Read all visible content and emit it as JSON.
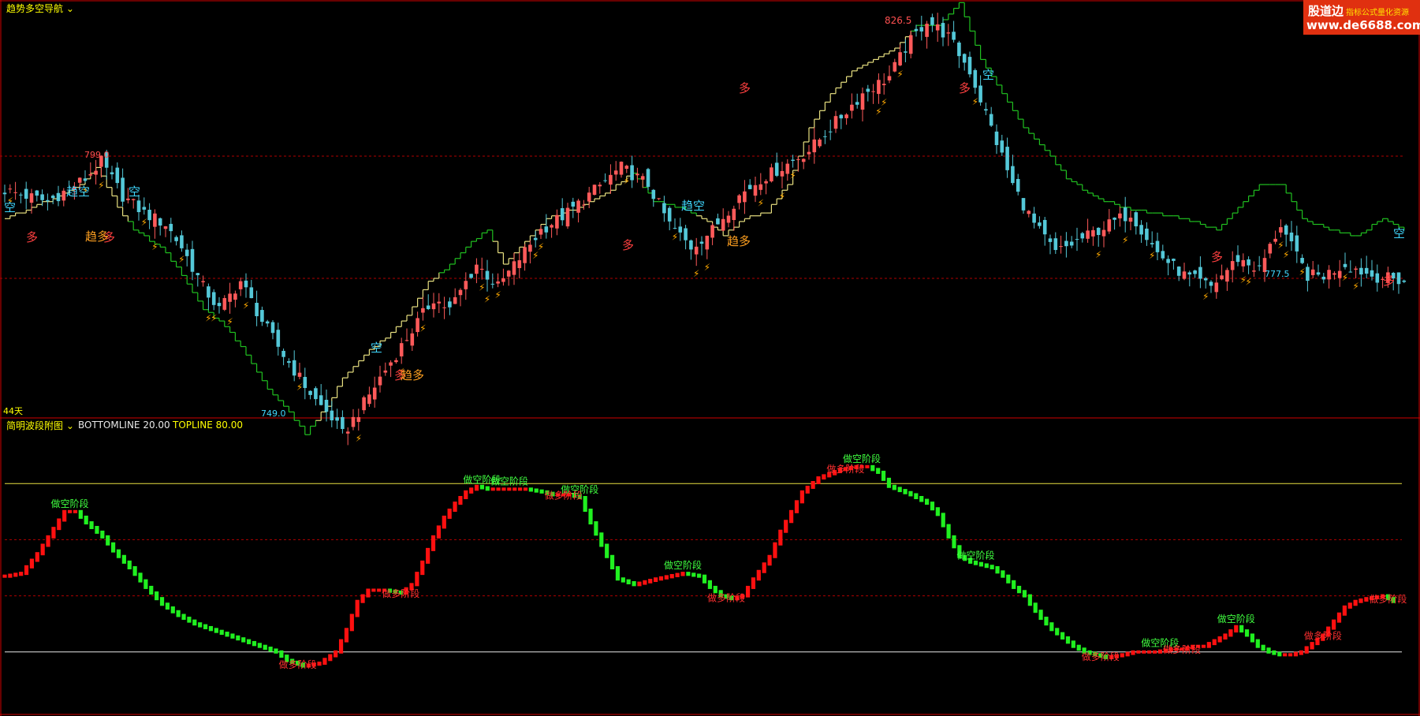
{
  "panels": {
    "main": {
      "title": "趋势多空导航",
      "days_label": "44天",
      "price_high_label": "826.5",
      "left_high_label": "799.0",
      "low_label": "749.0",
      "right_low_label": "777.5"
    },
    "sub": {
      "title": "简明波段附图",
      "bottom_label": "BOTTOMLINE 20.00",
      "top_label": "TOPLINE 80.00"
    }
  },
  "watermark": {
    "brand": "股道边",
    "tagline": "指标公式量化资源",
    "url": "www.de6688.com"
  },
  "colors": {
    "up": "#ff5a5a",
    "down": "#54c8d8",
    "bull_bar": "#ff1010",
    "bear_bar": "#20f020",
    "stop_up": "#e8e080",
    "stop_down": "#20c020",
    "grid": "#b00000",
    "frame": "#d00000"
  },
  "chart_data": [
    {
      "type": "candlestick",
      "title": "趋势多空导航",
      "reference_prices": [
        799.0,
        777.5
      ],
      "annotations": {
        "high": "826.5",
        "low": "749.0",
        "left_high": "799.0",
        "right_low": "777.5",
        "bull_text": "多",
        "bear_text": "空",
        "trend_bull_text": "趋多",
        "trend_bear_text": "趋空"
      },
      "close_path": [
        [
          0,
          793
        ],
        [
          8,
          791
        ],
        [
          15,
          795
        ],
        [
          18,
          798
        ],
        [
          22,
          792
        ],
        [
          26,
          789
        ],
        [
          30,
          787
        ],
        [
          33,
          783
        ],
        [
          37,
          776
        ],
        [
          40,
          772
        ],
        [
          44,
          777
        ],
        [
          48,
          770
        ],
        [
          52,
          764
        ],
        [
          55,
          760
        ],
        [
          58,
          756
        ],
        [
          61,
          753
        ],
        [
          63,
          750
        ],
        [
          66,
          754
        ],
        [
          70,
          760
        ],
        [
          75,
          767
        ],
        [
          80,
          774
        ],
        [
          83,
          772
        ],
        [
          88,
          780
        ],
        [
          92,
          776
        ],
        [
          96,
          781
        ],
        [
          100,
          786
        ],
        [
          105,
          789
        ],
        [
          110,
          793
        ],
        [
          115,
          797
        ],
        [
          120,
          794
        ],
        [
          124,
          787
        ],
        [
          128,
          783
        ],
        [
          132,
          786
        ],
        [
          137,
          792
        ],
        [
          141,
          795
        ],
        [
          145,
          797
        ],
        [
          150,
          800
        ],
        [
          156,
          806
        ],
        [
          160,
          810
        ],
        [
          165,
          813
        ],
        [
          168,
          818
        ],
        [
          172,
          823
        ],
        [
          176,
          820
        ],
        [
          180,
          814
        ],
        [
          184,
          804
        ],
        [
          188,
          794
        ],
        [
          192,
          787
        ],
        [
          196,
          782
        ],
        [
          200,
          784
        ],
        [
          206,
          787
        ],
        [
          210,
          789
        ],
        [
          215,
          782
        ],
        [
          220,
          778
        ],
        [
          225,
          776
        ],
        [
          230,
          781
        ],
        [
          234,
          779
        ],
        [
          238,
          787
        ],
        [
          240,
          783
        ],
        [
          243,
          778
        ],
        [
          246,
          778
        ],
        [
          250,
          780
        ],
        [
          255,
          778
        ],
        [
          261,
          777
        ]
      ],
      "stop_path": [
        [
          0,
          788
        ],
        [
          5,
          790
        ],
        [
          10,
          792
        ],
        [
          14,
          794
        ],
        [
          17,
          797
        ],
        [
          21,
          790
        ],
        [
          24,
          786
        ],
        [
          29,
          783
        ],
        [
          33,
          778
        ],
        [
          37,
          772
        ],
        [
          41,
          769
        ],
        [
          45,
          764
        ],
        [
          49,
          758
        ],
        [
          53,
          754
        ],
        [
          56,
          750
        ],
        [
          60,
          755
        ],
        [
          63,
          760
        ],
        [
          67,
          764
        ],
        [
          71,
          767
        ],
        [
          75,
          771
        ],
        [
          79,
          777
        ],
        [
          82,
          779
        ],
        [
          86,
          783
        ],
        [
          90,
          786
        ],
        [
          93,
          780
        ],
        [
          97,
          784
        ],
        [
          101,
          788
        ],
        [
          107,
          790
        ],
        [
          113,
          793
        ],
        [
          117,
          796
        ],
        [
          121,
          791
        ],
        [
          126,
          790
        ],
        [
          130,
          788
        ],
        [
          134,
          785
        ],
        [
          138,
          788
        ],
        [
          142,
          789
        ],
        [
          146,
          794
        ],
        [
          150,
          804
        ],
        [
          154,
          810
        ],
        [
          158,
          814
        ],
        [
          162,
          816
        ],
        [
          166,
          818
        ],
        [
          170,
          822
        ],
        [
          174,
          822
        ],
        [
          178,
          826
        ],
        [
          182,
          816
        ],
        [
          186,
          810
        ],
        [
          190,
          804
        ],
        [
          194,
          800
        ],
        [
          198,
          795
        ],
        [
          203,
          792
        ],
        [
          208,
          790
        ],
        [
          214,
          789
        ],
        [
          220,
          788
        ],
        [
          226,
          786
        ],
        [
          230,
          790
        ],
        [
          234,
          794
        ],
        [
          238,
          794
        ],
        [
          242,
          788
        ],
        [
          247,
          786
        ],
        [
          252,
          785
        ],
        [
          257,
          788
        ],
        [
          261,
          786
        ]
      ],
      "stop_modes": [
        [
          0,
          "up"
        ],
        [
          24,
          "down"
        ],
        [
          59,
          "up"
        ],
        [
          82,
          "down"
        ],
        [
          92,
          "up"
        ],
        [
          118,
          "down"
        ],
        [
          130,
          "up"
        ],
        [
          170,
          "down"
        ],
        [
          230,
          "down"
        ],
        [
          247,
          "down"
        ]
      ]
    },
    {
      "type": "bar",
      "title": "简明波段附图",
      "ylim": [
        0,
        100
      ],
      "reference_lines": [
        {
          "name": "BOTTOMLINE",
          "value": 20.0
        },
        {
          "name": "TOPLINE",
          "value": 80.0
        }
      ],
      "stage_labels": [
        "做空阶段",
        "做多阶段"
      ],
      "stage_annotations": [
        [
          12,
          "做空阶段",
          "bear"
        ],
        [
          88,
          "做空阶段",
          "bear"
        ],
        [
          93,
          "做空阶段",
          "bear"
        ],
        [
          106,
          "做空阶段",
          "bear"
        ],
        [
          125,
          "做空阶段",
          "bear"
        ],
        [
          158,
          "做空阶段",
          "bear"
        ],
        [
          179,
          "做空阶段",
          "bear"
        ],
        [
          213,
          "做空阶段",
          "bear"
        ],
        [
          227,
          "做空阶段",
          "bear"
        ],
        [
          54,
          "做多阶段",
          "bull"
        ],
        [
          73,
          "做多阶段",
          "bull"
        ],
        [
          103,
          "做多阶段",
          "bull"
        ],
        [
          133,
          "做多阶段",
          "bull"
        ],
        [
          155,
          "做多阶段",
          "bull"
        ],
        [
          202,
          "做多阶段",
          "bull"
        ],
        [
          217,
          "做多阶段",
          "bull"
        ],
        [
          243,
          "做多阶段",
          "bull"
        ],
        [
          255,
          "做多阶段",
          "bull"
        ]
      ],
      "wave_path": [
        [
          0,
          47
        ],
        [
          3,
          48
        ],
        [
          6,
          55
        ],
        [
          9,
          64
        ],
        [
          11,
          70
        ],
        [
          13,
          70
        ],
        [
          15,
          66
        ],
        [
          18,
          61
        ],
        [
          20,
          56
        ],
        [
          23,
          50
        ],
        [
          26,
          43
        ],
        [
          29,
          37
        ],
        [
          32,
          33
        ],
        [
          35,
          30
        ],
        [
          38,
          28
        ],
        [
          41,
          26
        ],
        [
          44,
          24
        ],
        [
          47,
          22
        ],
        [
          50,
          20
        ],
        [
          52,
          17
        ],
        [
          55,
          15
        ],
        [
          58,
          16
        ],
        [
          61,
          20
        ],
        [
          63,
          28
        ],
        [
          65,
          38
        ],
        [
          67,
          42
        ],
        [
          70,
          42
        ],
        [
          73,
          41
        ],
        [
          75,
          44
        ],
        [
          77,
          52
        ],
        [
          79,
          61
        ],
        [
          81,
          68
        ],
        [
          83,
          73
        ],
        [
          85,
          77
        ],
        [
          87,
          79
        ],
        [
          89,
          78
        ],
        [
          92,
          78
        ],
        [
          94,
          78
        ],
        [
          96,
          78
        ],
        [
          99,
          77
        ],
        [
          101,
          76
        ],
        [
          104,
          76
        ],
        [
          106,
          75
        ],
        [
          108,
          66
        ],
        [
          110,
          58
        ],
        [
          112,
          50
        ],
        [
          113,
          46
        ],
        [
          116,
          44
        ],
        [
          120,
          46
        ],
        [
          125,
          48
        ],
        [
          128,
          47
        ],
        [
          130,
          43
        ],
        [
          132,
          40
        ],
        [
          134,
          39
        ],
        [
          136,
          40
        ],
        [
          138,
          46
        ],
        [
          141,
          54
        ],
        [
          143,
          63
        ],
        [
          145,
          70
        ],
        [
          147,
          77
        ],
        [
          150,
          82
        ],
        [
          154,
          85
        ],
        [
          157,
          86
        ],
        [
          159,
          86
        ],
        [
          161,
          84
        ],
        [
          163,
          79
        ],
        [
          167,
          76
        ],
        [
          170,
          73
        ],
        [
          172,
          69
        ],
        [
          174,
          61
        ],
        [
          176,
          54
        ],
        [
          178,
          52
        ],
        [
          180,
          51
        ],
        [
          182,
          50
        ],
        [
          184,
          47
        ],
        [
          186,
          43
        ],
        [
          188,
          40
        ],
        [
          189,
          37
        ],
        [
          191,
          32
        ],
        [
          193,
          28
        ],
        [
          195,
          25
        ],
        [
          197,
          22
        ],
        [
          199,
          20
        ],
        [
          201,
          19
        ],
        [
          203,
          18
        ],
        [
          206,
          19
        ],
        [
          208,
          20
        ],
        [
          210,
          20
        ],
        [
          212,
          20
        ],
        [
          215,
          21
        ],
        [
          217,
          21
        ],
        [
          219,
          22
        ],
        [
          221,
          22
        ],
        [
          223,
          24
        ],
        [
          225,
          26
        ],
        [
          227,
          29
        ],
        [
          229,
          26
        ],
        [
          231,
          22
        ],
        [
          233,
          20
        ],
        [
          235,
          19
        ],
        [
          237,
          19
        ],
        [
          239,
          20
        ],
        [
          241,
          23
        ],
        [
          243,
          26
        ],
        [
          245,
          31
        ],
        [
          247,
          36
        ],
        [
          249,
          38
        ],
        [
          251,
          39
        ],
        [
          254,
          40
        ],
        [
          256,
          38
        ]
      ]
    }
  ]
}
